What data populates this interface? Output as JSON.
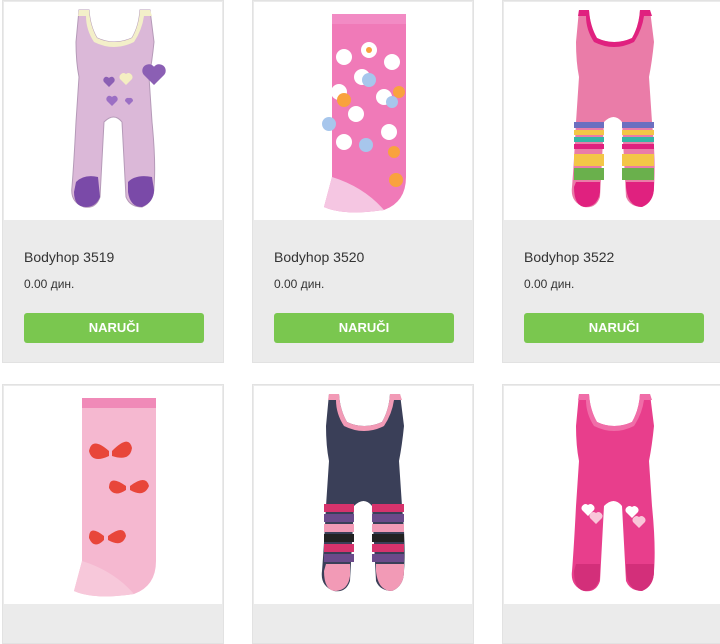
{
  "order_label": "NARUČI",
  "currency": "дин.",
  "products": [
    {
      "name": "Bodyhop 3519",
      "price": "0.00 дин.",
      "image_icon": "purple-hearts-romper-image"
    },
    {
      "name": "Bodyhop 3520",
      "price": "0.00 дин.",
      "image_icon": "pink-flower-tights-image"
    },
    {
      "name": "Bodyhop 3522",
      "price": "0.00 дин.",
      "image_icon": "striped-pink-romper-image"
    },
    {
      "name": "",
      "price": "",
      "image_icon": "butterfly-tights-image"
    },
    {
      "name": "",
      "price": "",
      "image_icon": "navy-striped-romper-image"
    },
    {
      "name": "",
      "price": "",
      "image_icon": "pink-hearts-romper-image"
    }
  ],
  "colors": {
    "button": "#7ac74f",
    "card_bg": "#ebebeb"
  }
}
